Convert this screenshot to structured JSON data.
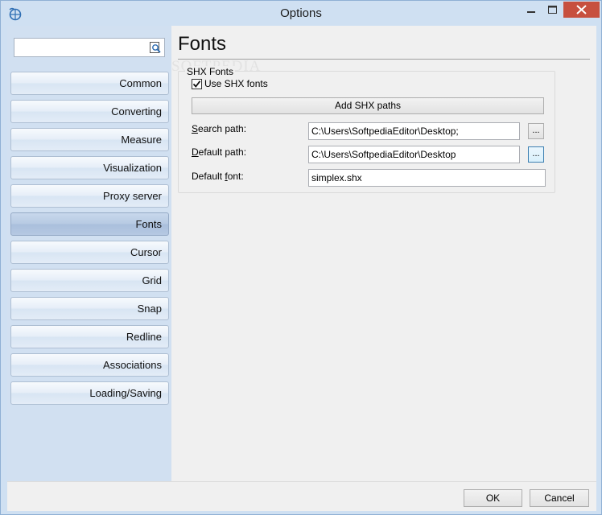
{
  "window": {
    "title": "Options"
  },
  "search": {
    "value": ""
  },
  "nav": {
    "items": [
      {
        "label": "Common"
      },
      {
        "label": "Converting"
      },
      {
        "label": "Measure"
      },
      {
        "label": "Visualization"
      },
      {
        "label": "Proxy server"
      },
      {
        "label": "Fonts"
      },
      {
        "label": "Cursor"
      },
      {
        "label": "Grid"
      },
      {
        "label": "Snap"
      },
      {
        "label": "Redline"
      },
      {
        "label": "Associations"
      },
      {
        "label": "Loading/Saving"
      }
    ],
    "selected": "Fonts"
  },
  "page": {
    "heading": "Fonts",
    "watermark": "SOFTPEDIA"
  },
  "shx": {
    "group_title": "SHX Fonts",
    "use_shx_label": "Use SHX fonts",
    "use_shx_checked": true,
    "add_paths_label": "Add SHX paths",
    "search_path_label_u": "S",
    "search_path_label_rest": "earch path:",
    "search_path_value": "C:\\Users\\SoftpediaEditor\\Desktop;",
    "default_path_label_u": "D",
    "default_path_label_rest": "efault path:",
    "default_path_value": "C:\\Users\\SoftpediaEditor\\Desktop",
    "default_font_label_pre": "Default ",
    "default_font_label_u": "f",
    "default_font_label_rest": "ont:",
    "default_font_value": "simplex.shx",
    "browse_label": "..."
  },
  "footer": {
    "ok_label": "OK",
    "cancel_label": "Cancel"
  },
  "colors": {
    "close_button": "#c7503f",
    "nav_selected": "#b7cae3",
    "frame": "#cfe0f2"
  }
}
